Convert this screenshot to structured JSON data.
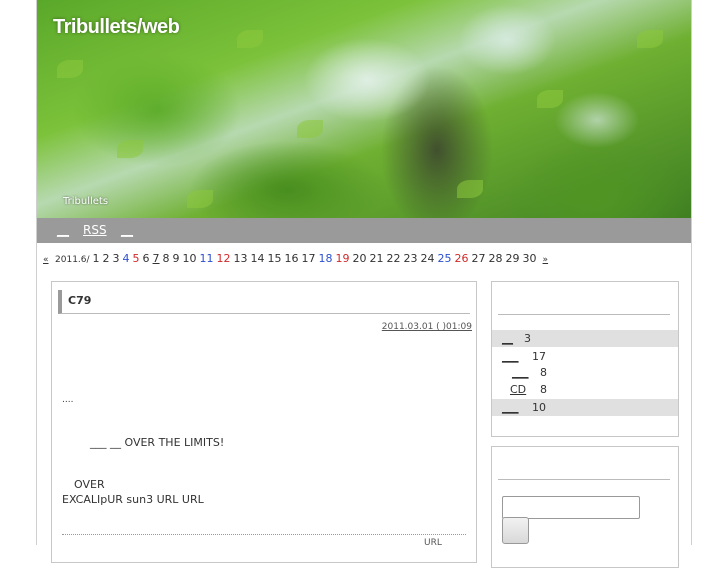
{
  "site": {
    "title": "Tribullets/web",
    "description": "Tribullets"
  },
  "nav": {
    "item1": "__",
    "rss": "RSS",
    "item3": "__"
  },
  "calendar": {
    "prev": "«",
    "month": "2011.6/",
    "next": "»",
    "days": [
      "1",
      "2",
      "3",
      "4",
      "5",
      "6",
      "7",
      "8",
      "9",
      "10",
      "11",
      "12",
      "13",
      "14",
      "15",
      "16",
      "17",
      "18",
      "19",
      "20",
      "21",
      "22",
      "23",
      "24",
      "25",
      "26",
      "27",
      "28",
      "29",
      "30"
    ],
    "blue_days": [
      "4",
      "11",
      "18",
      "25"
    ],
    "red_days": [
      "5",
      "12",
      "19",
      "26"
    ],
    "today": "7"
  },
  "entry": {
    "title": "C79",
    "date": "2011.03.01 ( )01:09",
    "line1": "....",
    "line2": "___ __   OVER THE LIMITS!",
    "line3": "OVER",
    "line4": "EXCALIpUR  sun3   URL              URL",
    "footer": "URL"
  },
  "sidebar": {
    "categories": [
      {
        "label": "__",
        "count": "3"
      },
      {
        "label": "___",
        "count": "17"
      },
      {
        "label": "___",
        "count": "8"
      },
      {
        "label": "CD",
        "count": "8"
      },
      {
        "label": "___",
        "count": "10"
      }
    ]
  },
  "search": {
    "placeholder": ""
  }
}
